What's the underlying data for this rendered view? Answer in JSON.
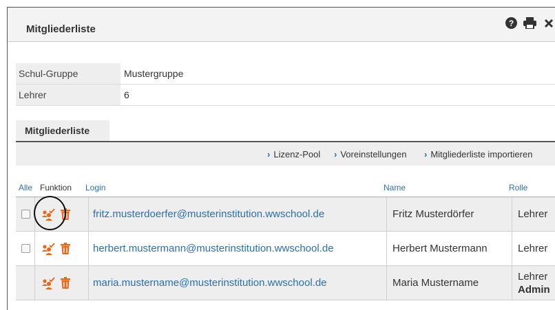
{
  "dialog": {
    "title": "Mitgliederliste",
    "icons": [
      "help-icon",
      "print-icon",
      "close-icon"
    ]
  },
  "info": {
    "rows": [
      {
        "label": "Schul-Gruppe",
        "value": "Mustergruppe"
      },
      {
        "label": "Lehrer",
        "value": "6"
      }
    ]
  },
  "section": {
    "tab_label": "Mitgliederliste",
    "links": [
      "Lizenz-Pool",
      "Voreinstellungen",
      "Mitgliederliste importieren"
    ]
  },
  "table": {
    "headers": {
      "alle": "Alle",
      "funktion": "Funktion",
      "login": "Login",
      "name": "Name",
      "rolle": "Rolle"
    },
    "rows": [
      {
        "login": "fritz.musterdoerfer@musterinstitution.wwschool.de",
        "name": "Fritz Musterdörfer",
        "role": "Lehrer",
        "role2": "",
        "checkbox": true
      },
      {
        "login": "herbert.mustermann@musterinstitution.wwschool.de",
        "name": "Herbert Mustermann",
        "role": "Lehrer",
        "role2": "",
        "checkbox": true
      },
      {
        "login": "maria.mustername@musterinstitution.wwschool.de",
        "name": "Maria Mustername",
        "role": "Lehrer",
        "role2": "Admin",
        "checkbox": false
      }
    ]
  },
  "colors": {
    "accent_orange": "#e8661a",
    "link_blue": "#2a6fb0"
  }
}
